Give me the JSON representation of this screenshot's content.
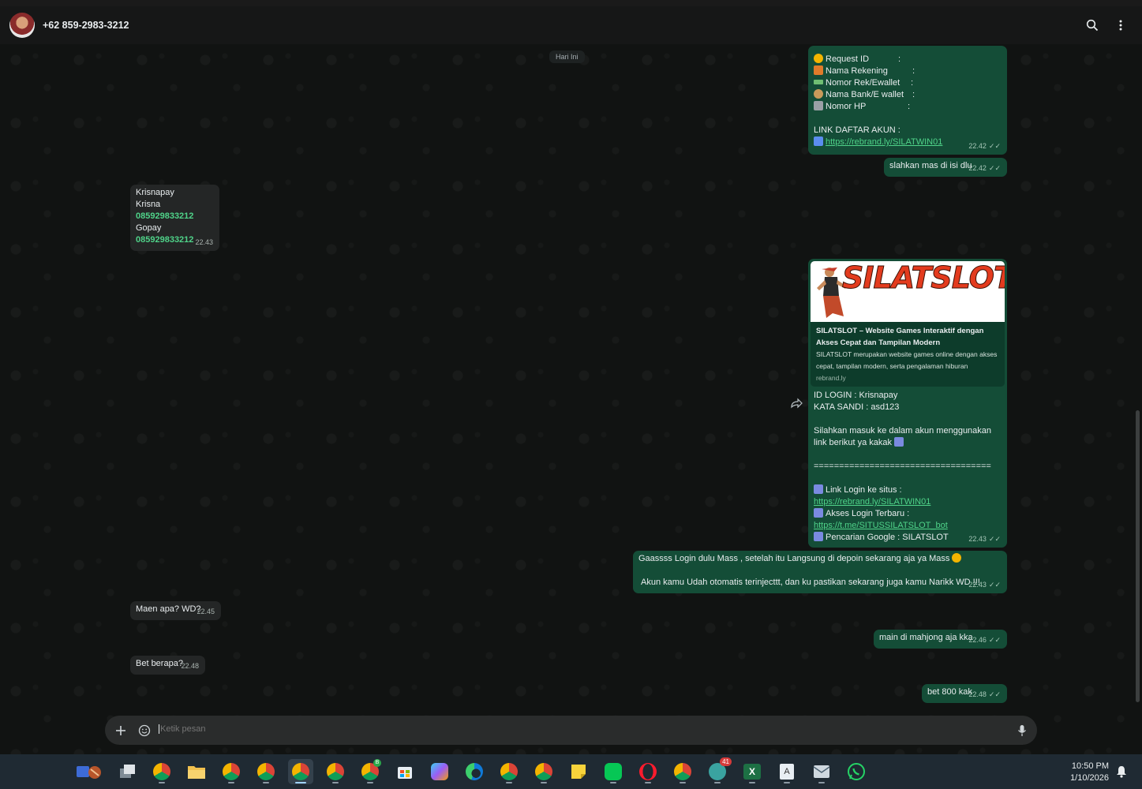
{
  "header": {
    "contact": "+62 859-2983-3212"
  },
  "date_chip": "Hari Ini",
  "messages": {
    "m1": {
      "rows": [
        {
          "label": "Request ID",
          "sep": ":"
        },
        {
          "label": "Nama Rekening",
          "sep": ":"
        },
        {
          "label": "Nomor Rek/Ewallet",
          "sep": ":"
        },
        {
          "label": "Nama Bank/E wallet",
          "sep": ":"
        },
        {
          "label": "Nomor HP",
          "sep": ":"
        }
      ],
      "link_heading": "LINK DAFTAR AKUN :",
      "link": "https://rebrand.ly/SILATWIN01",
      "time": "22.42"
    },
    "m2": {
      "text": "slahkan mas di isi dlu",
      "time": "22.42"
    },
    "m3": {
      "lines": [
        "Krisnapay",
        "Krisna"
      ],
      "phone1": "085929833212",
      "bank": "Gopay",
      "phone2": "085929833212",
      "time": "22.43"
    },
    "m4": {
      "banner": "SILATSLOT",
      "preview_title": "SILATSLOT – Website Games Interaktif dengan Akses Cepat dan Tampilan Modern",
      "preview_desc": "SILATSLOT merupakan website games online dengan akses cepat, tampilan modern, serta pengalaman hiburan",
      "preview_host": "rebrand.ly",
      "login_id": "ID LOGIN : Krisnapay",
      "password": "KATA SANDI : asd123",
      "instruction": "Silahkan masuk ke dalam akun menggunakan link berikut ya kakak",
      "divider": "===================================",
      "site_label": "Link Login ke situs  :",
      "site_link": "https://rebrand.ly/SILATWIN01",
      "access_label": "Akses Login Terbaru :",
      "access_link": "https://t.me/SITUSSILATSLOT_bot",
      "google_label": "Pencarian Google : SILATSLOT",
      "time": "22.43"
    },
    "m5": {
      "line1": "Gaassss Login dulu Mass  , setelah itu Langsung di depoin sekarang aja ya Mass",
      "line2": "Akun kamu Udah otomatis terinjecttt, dan ku pastikan sekarang juga kamu Narikk WD !!!",
      "time": "22.43"
    },
    "m6": {
      "text": "Maen apa? WD?",
      "time": "22.45"
    },
    "m7": {
      "text": "main di mahjong aja kka",
      "time": "22.46"
    },
    "m8": {
      "text": "Bet berapa?",
      "time": "22.48"
    },
    "m9": {
      "text": "bet 800 kak",
      "time": "22.48"
    }
  },
  "composer": {
    "placeholder": "Ketik pesan"
  },
  "taskbar": {
    "time": "10:50 PM",
    "date": "1/10/2026",
    "badge_count": "41",
    "badge_b": "B",
    "excel_glyph": "X",
    "text_glyph": "A"
  },
  "colors": {
    "outgoing": "#144d37",
    "incoming": "#242626",
    "link": "#4fd389",
    "header": "#161717"
  }
}
